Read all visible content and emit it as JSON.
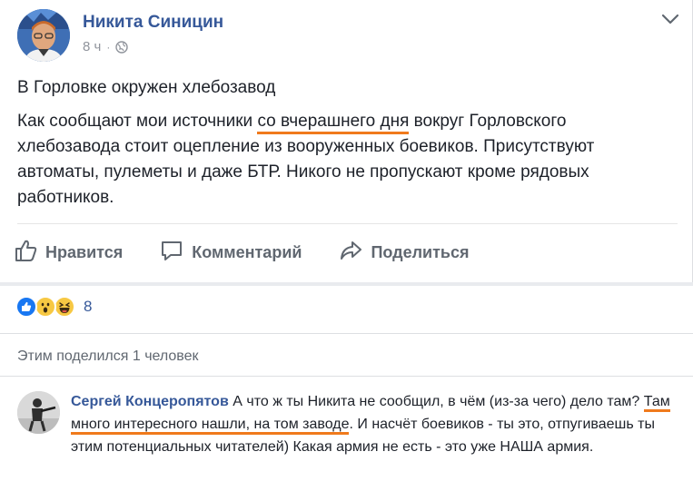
{
  "post": {
    "author": "Никита Синицин",
    "time": "8 ч",
    "dot": "·",
    "title": "В Горловке окружен хлебозавод",
    "body": {
      "part1": "Как сообщают мои источники ",
      "highlight": "со вчерашнего дня",
      "part2": " вокруг Горловского хлебозавода стоит оцепление из вооруженных боевиков. Присутствуют автоматы, пулеметы и даже БТР. Никого не пропускают кроме рядовых работников."
    }
  },
  "actions": {
    "like": "Нравится",
    "comment": "Комментарий",
    "share": "Поделиться"
  },
  "reactions": {
    "icons": [
      "like-icon",
      "wow-icon",
      "haha-icon"
    ],
    "count": "8"
  },
  "shares": {
    "text": "Этим поделился 1 человек"
  },
  "comment": {
    "author": "Сергей Концеропятов",
    "part1": " А что ж ты Никита не сообщил, в чём (из-за чего) дело там? ",
    "highlight": "Там много интересного нашли, на том заводе",
    "part2": ". И насчёт боевиков - ты это, отпугиваешь ты этим потенциальных читателей) Какая армия не есть - это уже НАША армия."
  },
  "colors": {
    "link": "#365899",
    "highlight": "#f07a1c",
    "like_blue": "#1877f2",
    "emoji_yellow": "#f7c843"
  }
}
